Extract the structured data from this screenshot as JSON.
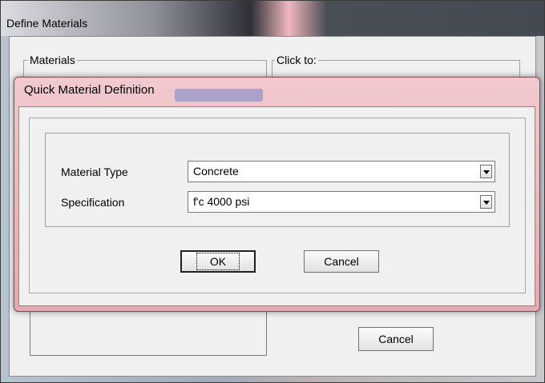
{
  "background_window": {
    "title": "Define Materials",
    "materials_group_label": "Materials",
    "click_to_group_label": "Click to:",
    "cancel_label": "Cancel"
  },
  "dialog": {
    "title": "Quick Material Definition",
    "material_type_label": "Material Type",
    "material_type_value": "Concrete",
    "specification_label": "Specification",
    "specification_value": "f'c 4000 psi",
    "ok_label": "OK",
    "cancel_label": "Cancel"
  }
}
